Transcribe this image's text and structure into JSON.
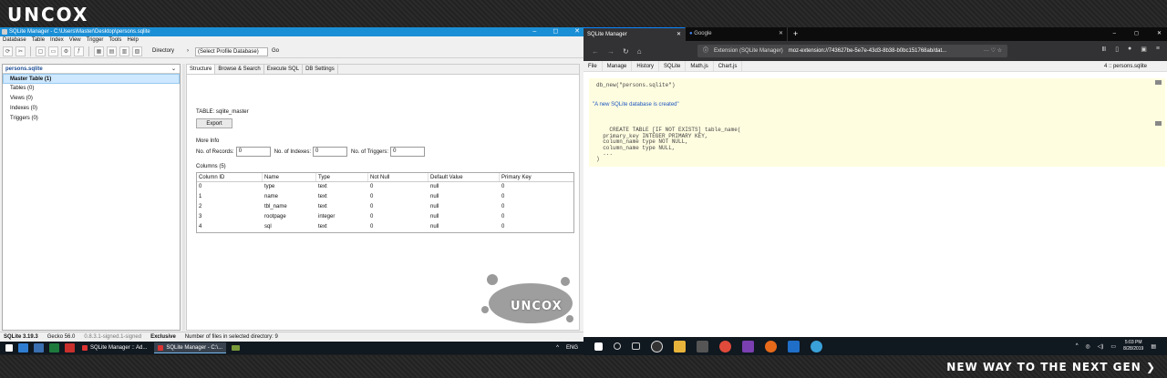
{
  "banner": {
    "logo": "UNCOX",
    "slogan": "NEW WAY TO THE NEXT GEN ❯"
  },
  "left_app": {
    "title": "SQLite Manager - C:\\Users\\Master\\Desktop\\persons.sqlite",
    "menu": [
      "Database",
      "Table",
      "Index",
      "View",
      "Trigger",
      "Tools",
      "Help"
    ],
    "toolbar": {
      "directory_label": "Directory",
      "profile_value": "(Select Profile Database)",
      "go_label": "Go"
    },
    "db_name": "persons.sqlite",
    "tree": [
      "Master Table (1)",
      "Tables (0)",
      "Views (0)",
      "Indexes (0)",
      "Triggers (0)"
    ],
    "tabs": [
      "Structure",
      "Browse & Search",
      "Execute SQL",
      "DB Settings"
    ],
    "table_label": "TABLE: sqlite_master",
    "export_label": "Export",
    "more_info": "More Info",
    "records_label": "No. of Records:",
    "records_value": "0",
    "indexes_label": "No. of Indexes:",
    "indexes_value": "0",
    "triggers_label": "No. of Triggers:",
    "triggers_value": "0",
    "columns_label": "Columns (5)",
    "columns_head": [
      "Column ID",
      "Name",
      "Type",
      "Not Null",
      "Default Value",
      "Primary Key"
    ],
    "columns_rows": [
      [
        "0",
        "type",
        "text",
        "0",
        "null",
        "0"
      ],
      [
        "1",
        "name",
        "text",
        "0",
        "null",
        "0"
      ],
      [
        "2",
        "tbl_name",
        "text",
        "0",
        "null",
        "0"
      ],
      [
        "3",
        "rootpage",
        "integer",
        "0",
        "null",
        "0"
      ],
      [
        "4",
        "sql",
        "text",
        "0",
        "null",
        "0"
      ]
    ],
    "status": {
      "version": "SQLite 3.19.3",
      "gecko": "Gecko 56.0",
      "addon": "0.8.3.1-signed.1-signed",
      "mode": "Exclusive",
      "files": "Number of files in selected directory: 9"
    },
    "watermark": "UNCOX"
  },
  "taskbar_left": {
    "buttons": [
      "SQLite Manager :: Ad...",
      "SQLite Manager - C:\\..."
    ],
    "lang": "ENG"
  },
  "browser": {
    "tabs": [
      "SQLite Manager",
      "Google"
    ],
    "url_ext": "Extension (SQLite Manager)",
    "url": "moz-extension://743627be-5e7e-43d3-8b38-b0bc151768ab/dat...",
    "menu": [
      "File",
      "Manage",
      "History",
      "SQLite",
      "Math.js",
      "Chart.js"
    ],
    "db_label": "4 :: persons.sqlite",
    "code1": "db_new(\"persons.sqlite\")",
    "message": "\"A new SQLite database is created\"",
    "code2": "CREATE TABLE [IF NOT EXISTS] table_name(\n  primary_key INTEGER PRIMARY KEY,\n  column_name type NOT NULL,\n  column_name type NULL,\n  ...\n)"
  },
  "taskbar_right": {
    "time": "5:03 PM",
    "date": "8/28/2019"
  },
  "colors": {
    "titlebar": "#1b8fd6",
    "browser_dark": "#323234",
    "code_bg": "#fffde0",
    "selection": "#cde8ff"
  }
}
